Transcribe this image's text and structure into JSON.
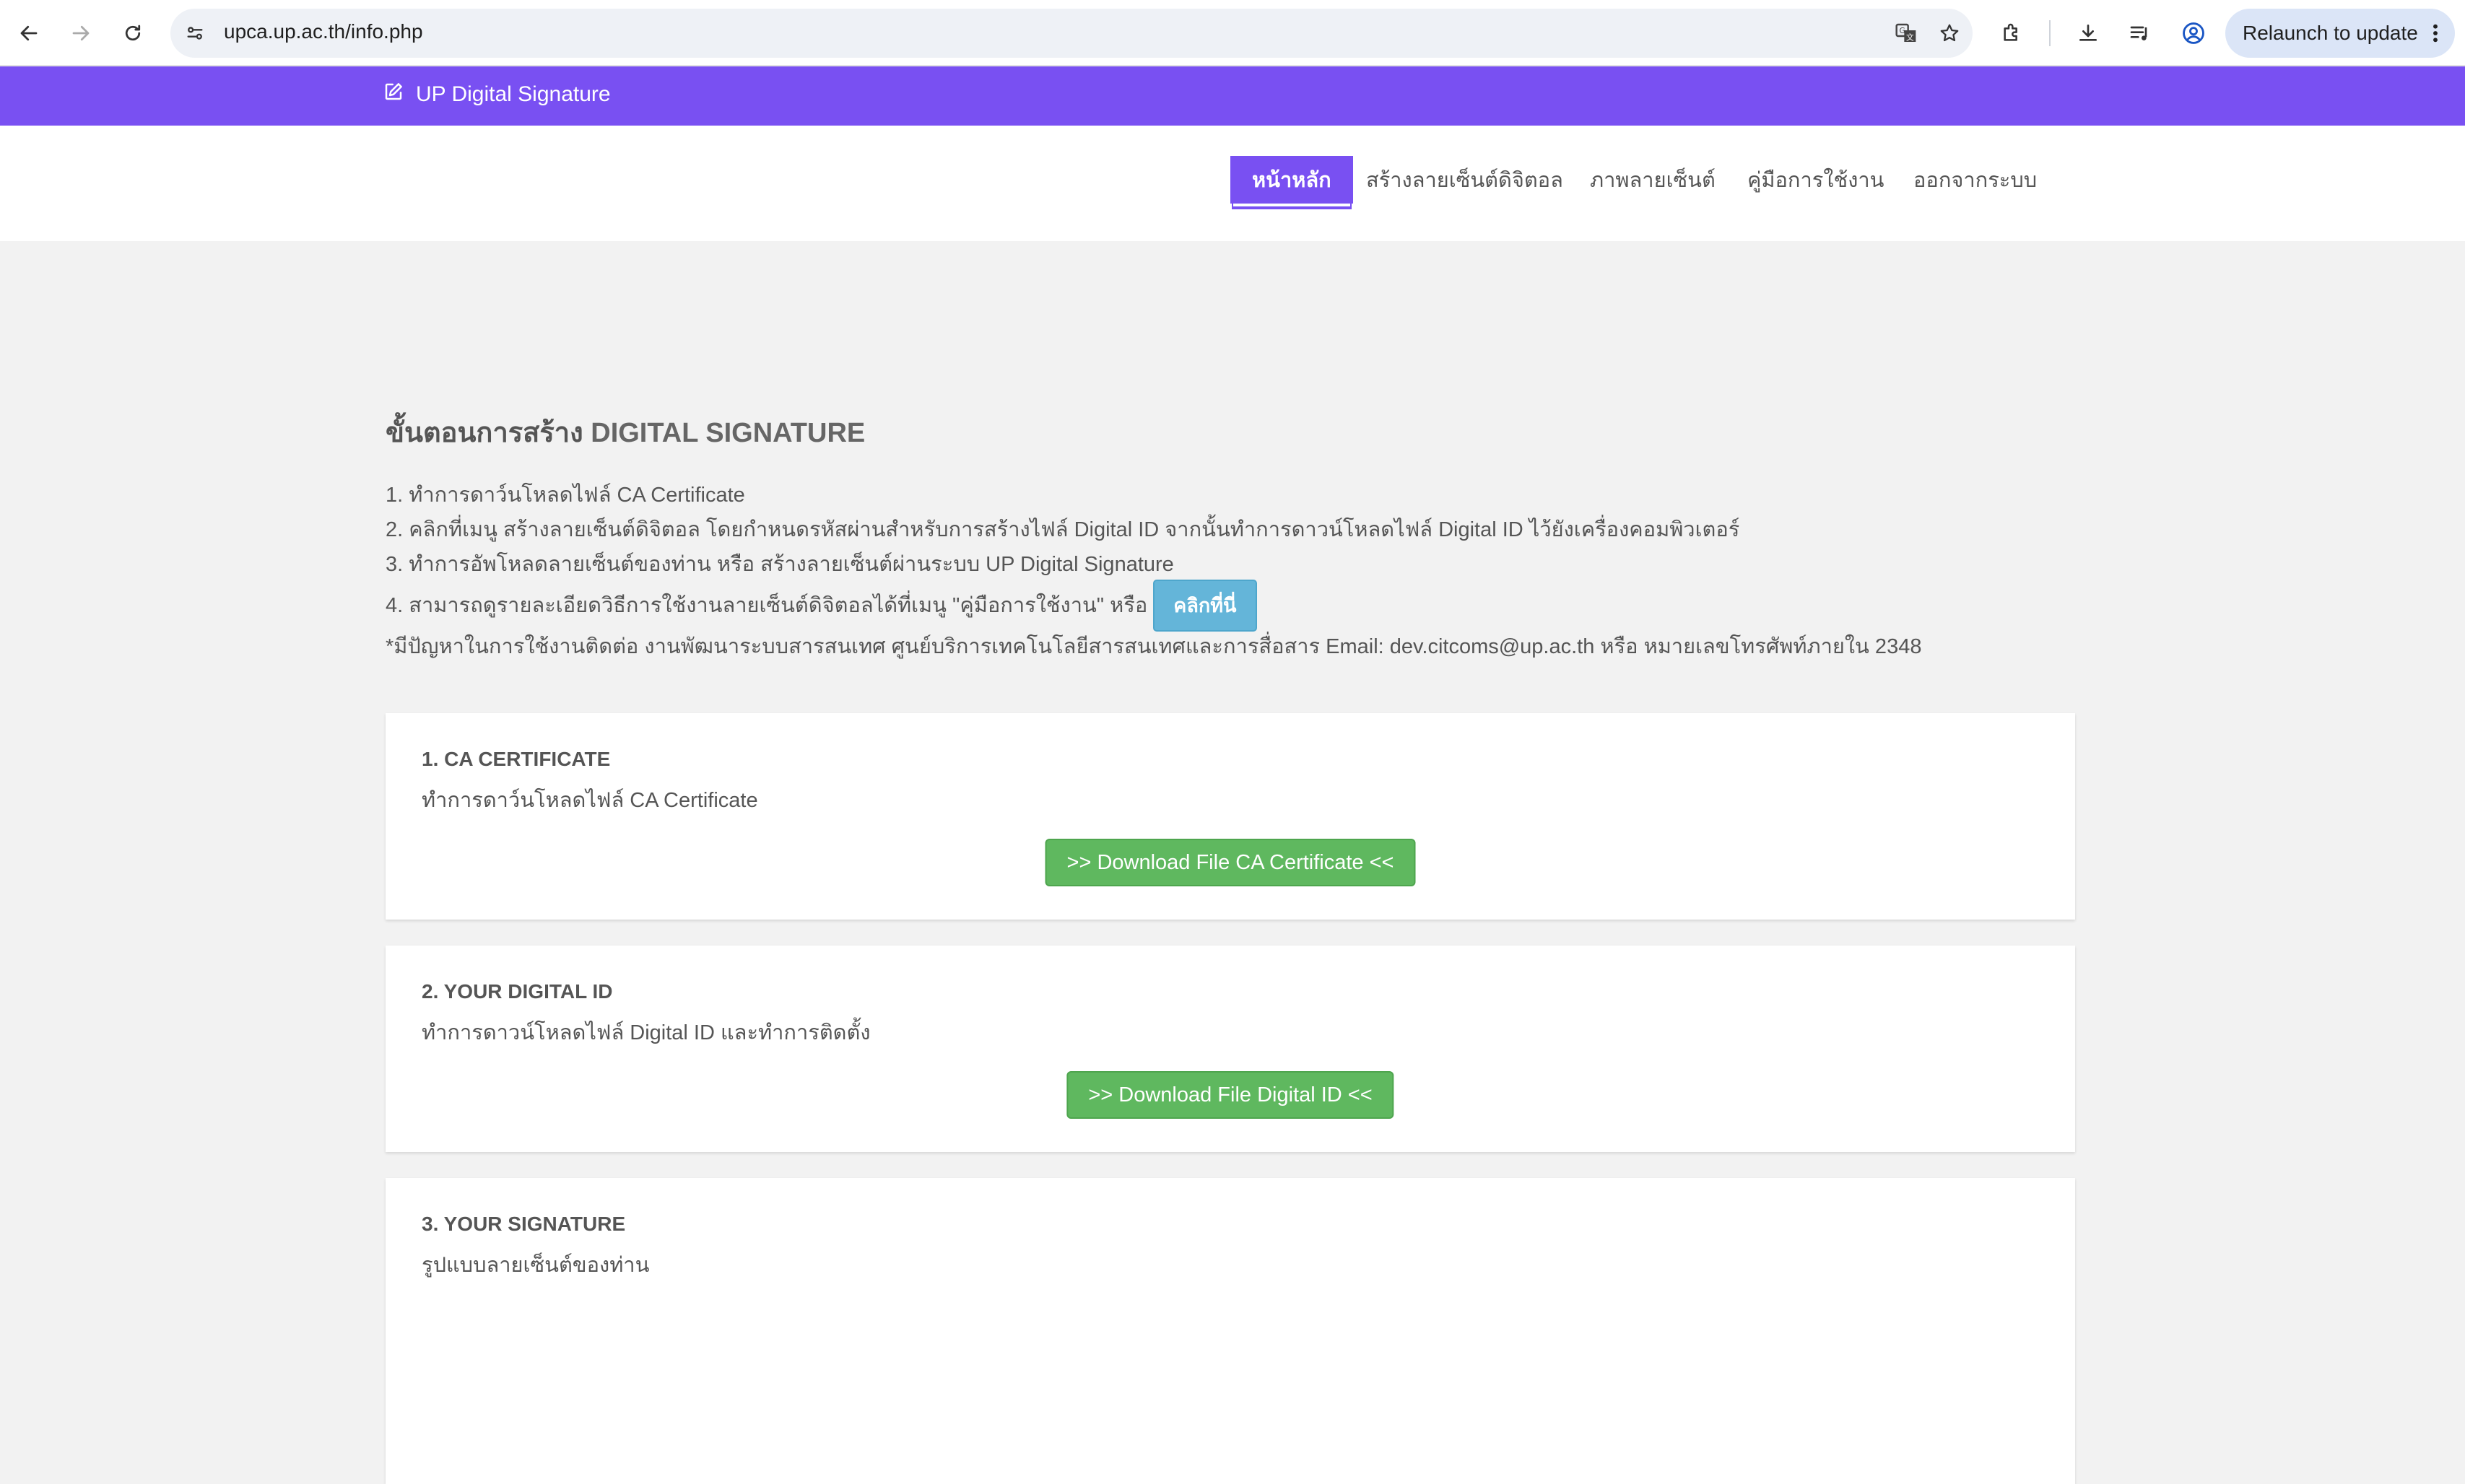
{
  "browser": {
    "url": "upca.up.ac.th/info.php",
    "relaunch_label": "Relaunch to update"
  },
  "brand": {
    "title": "UP Digital Signature"
  },
  "nav": {
    "items": [
      {
        "label": "หน้าหลัก",
        "active": true
      },
      {
        "label": "สร้างลายเซ็นต์ดิจิตอล"
      },
      {
        "label": "ภาพลายเซ็นต์"
      },
      {
        "label": "คู่มือการใช้งาน"
      },
      {
        "label": "ออกจากระบบ"
      }
    ]
  },
  "main": {
    "title_prefix": "ขั้นตอนการสร้าง",
    "title_bold": "DIGITAL SIGNATURE",
    "steps": [
      "1. ทำการดาว์นโหลดไฟล์ CA Certificate",
      "2. คลิกที่เมนู สร้างลายเซ็นต์ดิจิตอล โดยกำหนดรหัสผ่านสำหรับการสร้างไฟล์ Digital ID จากนั้นทำการดาวน์โหลดไฟล์ Digital ID ไว้ยังเครื่องคอมพิวเตอร์",
      "3. ทำการอัพโหลดลายเซ็นต์ของท่าน หรือ สร้างลายเซ็นต์ผ่านระบบ UP Digital Signature",
      "4. สามารถดูรายละเอียดวิธีการใช้งานลายเซ็นต์ดิจิตอลได้ที่เมนู \"คู่มือการใช้งาน\" หรือ"
    ],
    "click_here_label": "คลิกที่นี่",
    "contact_note": "*มีปัญหาในการใช้งานติดต่อ งานพัฒนาระบบสารสนเทศ ศูนย์บริการเทคโนโลยีสารสนเทศและการสื่อสาร Email: dev.citcoms@up.ac.th หรือ หมายเลขโทรศัพท์ภายใน 2348"
  },
  "cards": {
    "ca": {
      "heading": "1. CA CERTIFICATE",
      "desc": "ทำการดาว์นโหลดไฟล์ CA Certificate",
      "button": ">> Download File CA Certificate <<"
    },
    "digital_id": {
      "heading": "2. YOUR DIGITAL ID",
      "desc": "ทำการดาวน์โหลดไฟล์ Digital ID และทำการติดตั้ง",
      "button": ">> Download File Digital ID <<"
    },
    "signature": {
      "heading": "3. YOUR SIGNATURE",
      "desc": "รูปแบบลายเซ็นต์ของท่าน"
    }
  },
  "colors": {
    "brand_purple": "#7950f2",
    "download_green": "#5fb85f",
    "info_blue": "#64b5d9"
  }
}
